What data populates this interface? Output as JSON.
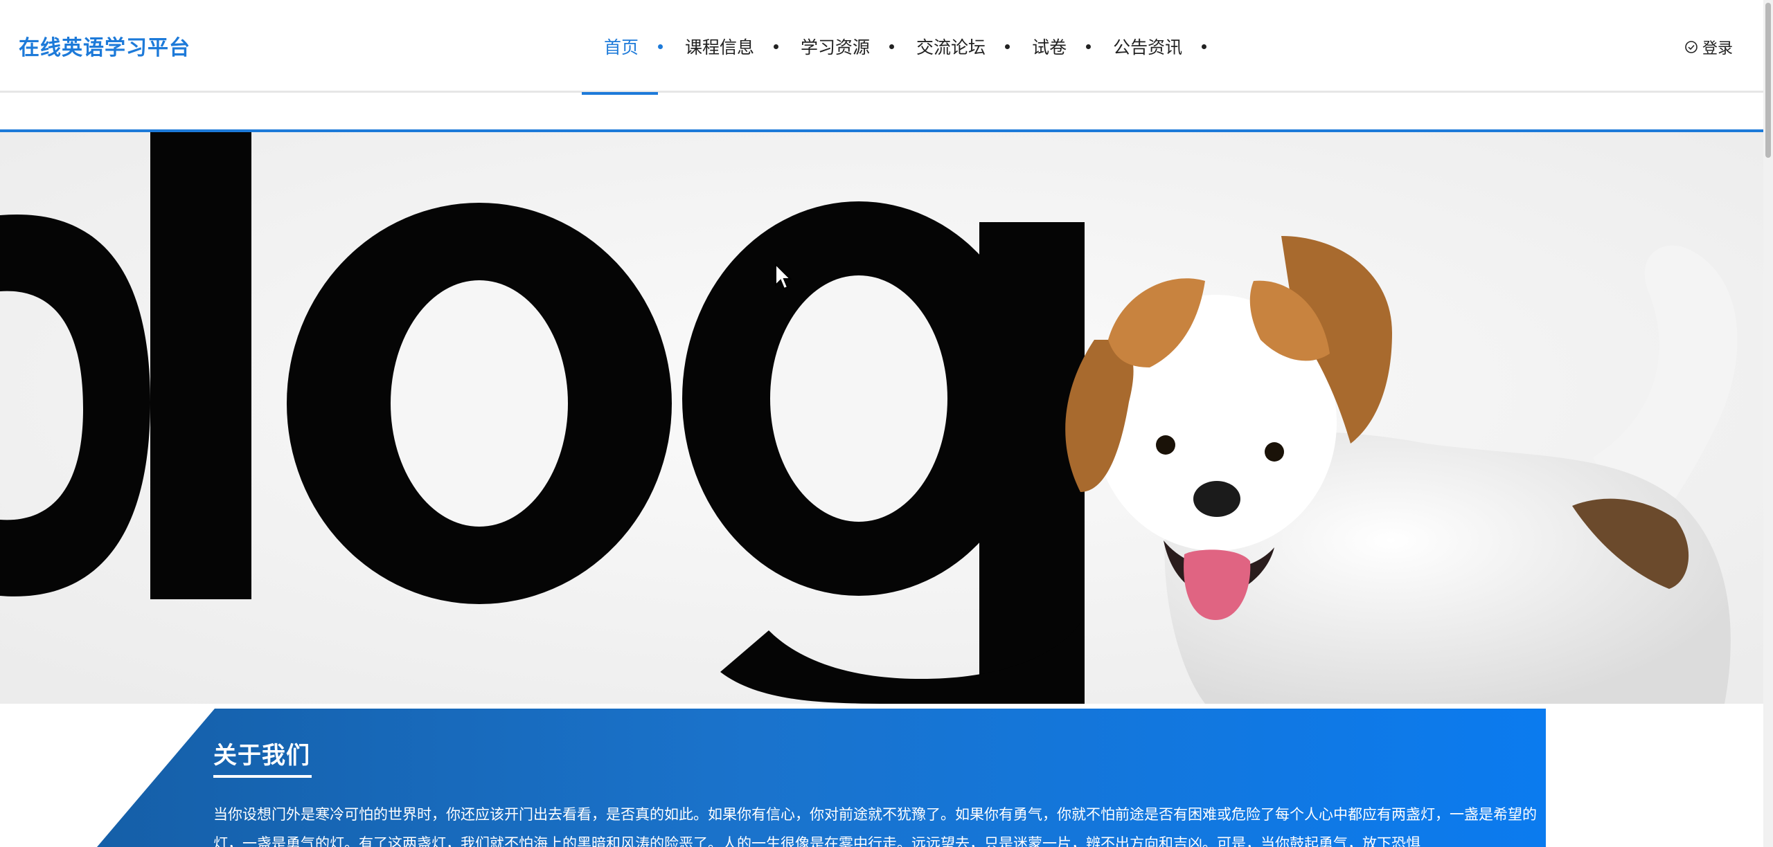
{
  "brand": {
    "title": "在线英语学习平台",
    "color": "#1d7ad9"
  },
  "nav": {
    "items": [
      {
        "label": "首页",
        "active": true
      },
      {
        "label": "课程信息",
        "active": false
      },
      {
        "label": "学习资源",
        "active": false
      },
      {
        "label": "交流论坛",
        "active": false
      },
      {
        "label": "试卷",
        "active": false
      },
      {
        "label": "公告资讯",
        "active": false
      }
    ],
    "login_label": "登录",
    "login_icon": "check-circle-icon"
  },
  "hero": {
    "word": "dog",
    "image": "dog-photo",
    "slide_count": 1,
    "active_slide": 1
  },
  "about": {
    "title": "关于我们",
    "text": "当你设想门外是寒冷可怕的世界时，你还应该开门出去看看，是否真的如此。如果你有信心，你对前途就不犹豫了。如果你有勇气，你就不怕前途是否有困难或危险了每个人心中都应有两盏灯，一盏是希望的灯，一盏是勇气的灯。有了这两盏灯，我们就不怕海上的黑暗和风涛的险恶了。人的一生很像是在雾中行走。远远望去，只是迷蒙一片，辨不出方向和吉凶。可是，当你鼓起勇气，放下恐惧"
  },
  "colors": {
    "accent": "#1d7ad9",
    "panel_start": "#155fa8",
    "panel_end": "#0b7bef"
  }
}
